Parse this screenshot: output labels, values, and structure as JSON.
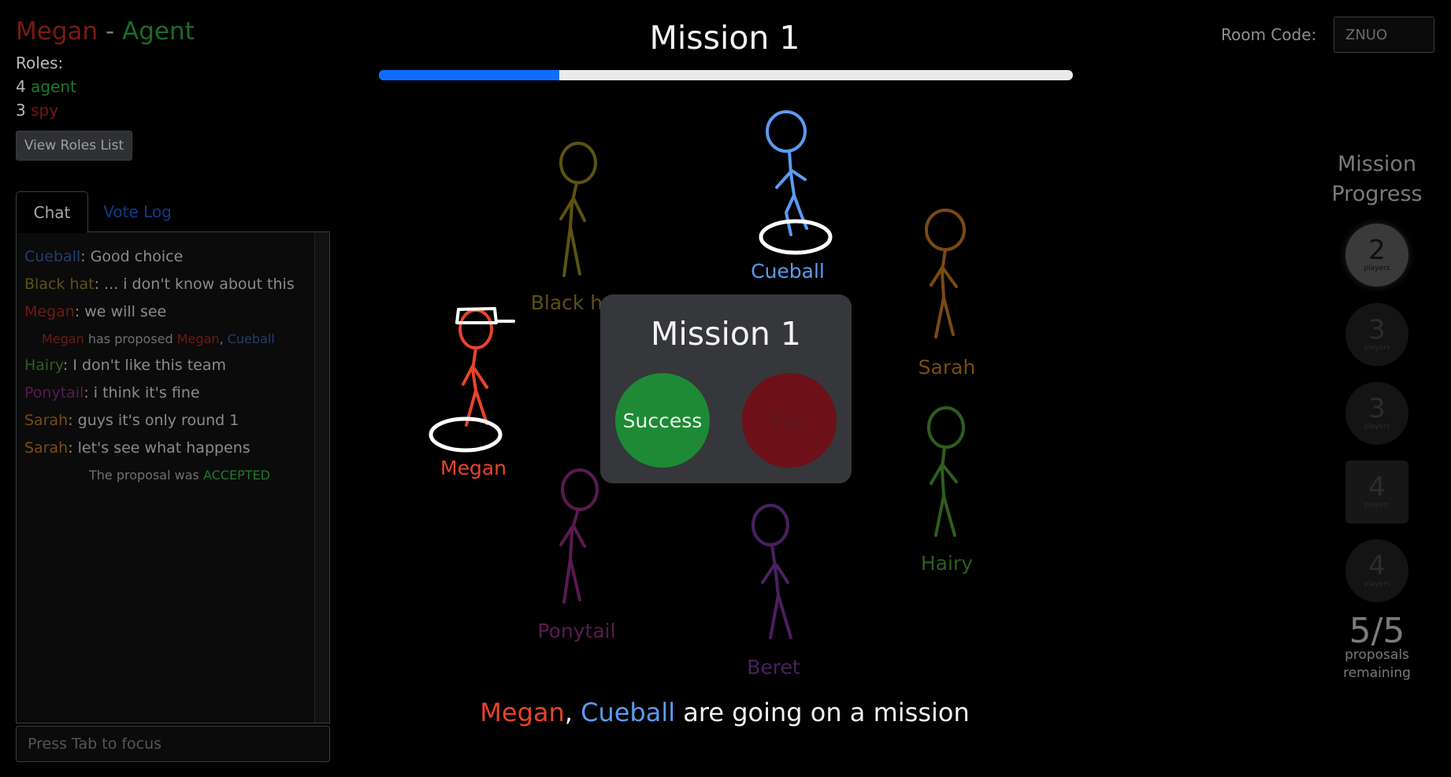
{
  "player": {
    "name": "Megan",
    "separator": "-",
    "role": "Agent"
  },
  "roles": {
    "label": "Roles:",
    "agent_count": "4",
    "agent_label": "agent",
    "spy_count": "3",
    "spy_label": "spy",
    "view_button": "View Roles List"
  },
  "chat": {
    "tabs": [
      "Chat",
      "Vote Log"
    ],
    "messages": [
      {
        "author": "Cueball",
        "text": ": Good choice"
      },
      {
        "author": "Black hat",
        "text": ": ... i don't know about this"
      },
      {
        "author": "Megan",
        "text": ": we will see"
      },
      {
        "author": "Hairy",
        "text": ": I don't like this team"
      },
      {
        "author": "Ponytail",
        "text": ": i think it's fine"
      },
      {
        "author": "Sarah",
        "text": ": guys it's only round 1"
      },
      {
        "author": "Sarah",
        "text": ": let's see what happens"
      }
    ],
    "proposal": {
      "who": "Megan",
      "middle": " has proposed ",
      "team1": "Megan",
      "comma": ", ",
      "team2": "Cueball"
    },
    "result": {
      "prefix": "The proposal was ",
      "status": "ACCEPTED"
    },
    "input_placeholder": "Press Tab to focus"
  },
  "header": {
    "title": "Mission 1",
    "progress": 0.26
  },
  "room": {
    "label": "Room Code:",
    "code": "ZNUO"
  },
  "players": [
    {
      "name": "Cueball",
      "color": "#5b9bf0",
      "dim": false,
      "on_team": true
    },
    {
      "name": "Sarah",
      "color": "#7a4a12",
      "dim": true,
      "on_team": false
    },
    {
      "name": "Hairy",
      "color": "#2e5e1e",
      "dim": true,
      "on_team": false
    },
    {
      "name": "Beret",
      "color": "#4a2060",
      "dim": true,
      "on_team": false
    },
    {
      "name": "Ponytail",
      "color": "#5a1a50",
      "dim": true,
      "on_team": false
    },
    {
      "name": "Megan",
      "color": "#e8432b",
      "dim": false,
      "on_team": true,
      "hat": true
    },
    {
      "name": "Black hat",
      "color": "#5c5212",
      "dim": true,
      "on_team": false
    }
  ],
  "vote": {
    "title": "Mission 1",
    "success": "Success",
    "fail": "Fail"
  },
  "status": {
    "name1": "Megan",
    "sep": ",",
    "name2": "Cueball",
    "suffix": "are going on a mission"
  },
  "mission_progress": {
    "title_line1": "Mission",
    "title_line2": "Progress",
    "missions": [
      {
        "players": "2",
        "label": "players",
        "current": true
      },
      {
        "players": "3",
        "label": "players"
      },
      {
        "players": "3",
        "label": "players"
      },
      {
        "players": "4",
        "label": "players",
        "special": true
      },
      {
        "players": "4",
        "label": "players"
      }
    ],
    "proposals": "5/5",
    "proposals_label_1": "proposals",
    "proposals_label_2": "remaining"
  },
  "colors": {
    "megan": "#e8432b",
    "cueball": "#5b9bf0",
    "black_hat": "#5c5212",
    "hairy": "#2e5e1e",
    "ponytail": "#5a1a50",
    "sarah": "#7a4a12",
    "agent": "#1d7a2b",
    "spy": "#7a1414",
    "accepted": "#1d7a2b",
    "accent": "#0d6efd"
  }
}
